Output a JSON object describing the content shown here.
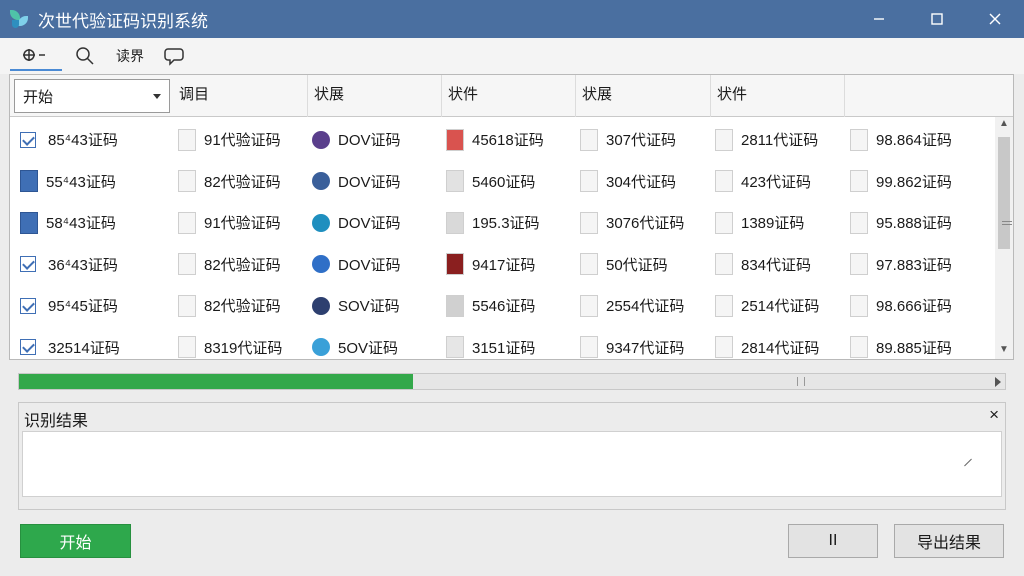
{
  "window": {
    "title": "次世代验证码识别系统"
  },
  "toolbar": {
    "items": [
      {
        "label": "",
        "icon": "add-icon"
      },
      {
        "label": "",
        "icon": "search-icon"
      },
      {
        "label": "读界",
        "icon": ""
      },
      {
        "label": "",
        "icon": "chat-icon"
      }
    ]
  },
  "table": {
    "headers": [
      "开始",
      "调目",
      "状展",
      "状件",
      "状展",
      "状件",
      ""
    ],
    "rows": [
      [
        "85⁴43证码",
        "91代验证码",
        "DOV证码",
        "45618证码",
        "307代证码",
        "2811代证码",
        "98.864证码"
      ],
      [
        "55⁴43证码",
        "82代验证码",
        "DOV证码",
        "5460证码",
        "304代证码",
        "423代证码",
        "99.862证码"
      ],
      [
        "58⁴43证码",
        "91代验证码",
        "DOV证码",
        "195.3证码",
        "3076代证码",
        "1389证码",
        "95.888证码"
      ],
      [
        "36⁴43证码",
        "82代验证码",
        "DOV证码",
        "9417证码",
        "50代证码",
        "834代证码",
        "97.883证码"
      ],
      [
        "95⁴45证码",
        "82代验证码",
        "SOV证码",
        "5546证码",
        "2554代证码",
        "2514代证码",
        "98.666证码"
      ],
      [
        "32514证码",
        "8319代证码",
        "5OV证码",
        "3151证码",
        "9347代证码",
        "2814代证码",
        "89.885证码"
      ]
    ]
  },
  "progress": {
    "value": 0.4
  },
  "result_panel": {
    "title": "识别结果",
    "text": ""
  },
  "buttons": {
    "start": "开始",
    "pause": "II",
    "export": "导出结果"
  },
  "colors": {
    "titlebar": "#4a6fa0",
    "accent_green": "#2ea84c"
  }
}
